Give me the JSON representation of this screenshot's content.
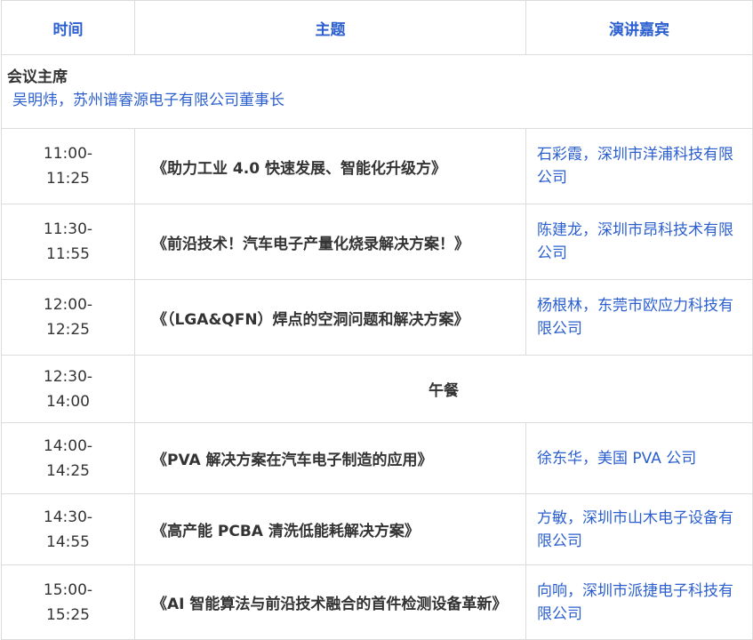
{
  "header": {
    "time": "时间",
    "topic": "主题",
    "speaker": "演讲嘉宾"
  },
  "chair": {
    "title": "会议主席",
    "name": "吴明炜，苏州谱睿源电子有限公司董事长"
  },
  "rows": [
    {
      "start": "11:00-",
      "end": "11:25",
      "topic": "《助力工业 4.0 快速发展、智能化升级方》",
      "speaker": "石彩霞，深圳市洋浦科技有限公司"
    },
    {
      "start": "11:30-",
      "end": "11:55",
      "topic": "《前沿技术！汽车电子产量化烧录解决方案！》",
      "speaker": "陈建龙，深圳市昂科技术有限公司"
    },
    {
      "start": "12:00-",
      "end": "12:25",
      "topic": "《（LGA&QFN）焊点的空洞问题和解决方案》",
      "speaker": "杨根林，东莞市欧应力科技有限公司"
    },
    {
      "start": "12:30-",
      "end": "14:00",
      "topic": "午餐",
      "speaker": ""
    },
    {
      "start": "14:00-",
      "end": "14:25",
      "topic": "《PVA 解决方案在汽车电子制造的应用》",
      "speaker": "徐东华，美国 PVA 公司"
    },
    {
      "start": "14:30-",
      "end": "14:55",
      "topic": "《高产能 PCBA 清洗低能耗解决方案》",
      "speaker": "方敏，深圳市山木电子设备有限公司"
    },
    {
      "start": "15:00-",
      "end": "15:25",
      "topic": "《AI 智能算法与前沿技术融合的首件检测设备革新》",
      "speaker": "向响，深圳市派捷电子科技有限公司"
    }
  ]
}
